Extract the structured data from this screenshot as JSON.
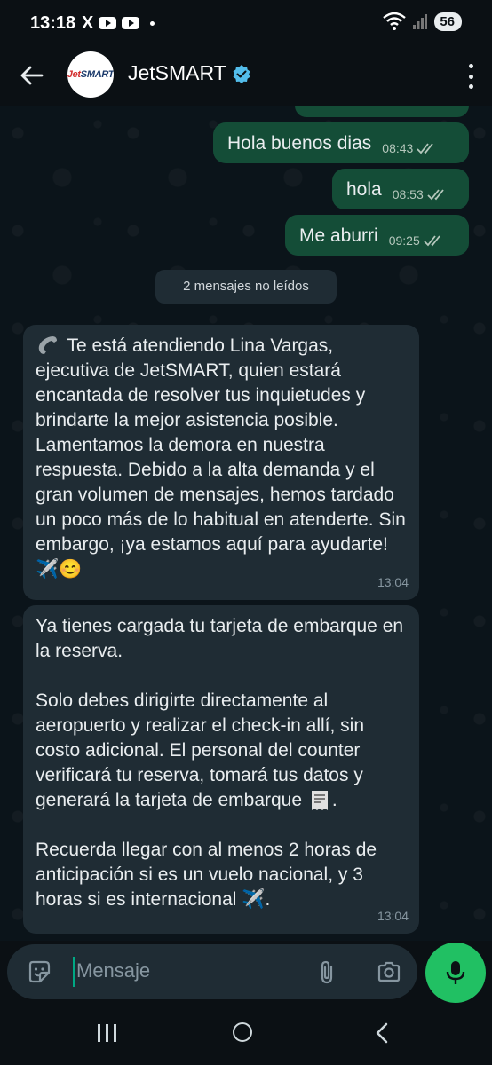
{
  "status_bar": {
    "time": "13:18",
    "x_icon": "X",
    "battery": "56"
  },
  "header": {
    "name": "JetSMART",
    "avatar_text_a": "Jet",
    "avatar_text_b": "SMART"
  },
  "chat": {
    "outgoing": [
      {
        "text": "Hola buenos dias",
        "time": "08:43"
      },
      {
        "text": "hola",
        "time": "08:53"
      },
      {
        "text": "Me aburri",
        "time": "09:25"
      }
    ],
    "unread_label": "2 mensajes no leídos",
    "incoming": [
      {
        "prefix_icon": "telephone-icon",
        "text": "Te está atendiendo Lina Vargas, ejecutiva de JetSMART, quien estará encantada de resolver tus inquietudes y brindarte la mejor asistencia posible. Lamentamos la demora en nuestra respuesta. Debido a la alta demanda y el gran volumen de mensajes, hemos tardado un poco más de lo habitual en atenderte. Sin embargo, ¡ya estamos aquí para ayudarte!",
        "emojis": "✈️😊",
        "time": "13:04"
      },
      {
        "p1": "Ya tienes cargada tu tarjeta de embarque en la reserva.",
        "p2": "Solo debes dirigirte directamente al aeropuerto y realizar el check-in allí, sin costo adicional. El personal del counter verificará tu reserva, tomará tus datos y generará la tarjeta de embarque",
        "p2_end": ".",
        "p3": "Recuerda llegar con al menos 2 horas de anticipación si es un vuelo nacional, y 3 horas si es internacional",
        "p3_emoji": "✈️",
        "p3_end": ".",
        "time": "13:04"
      }
    ]
  },
  "input": {
    "placeholder": "Mensaje"
  },
  "colors": {
    "accent": "#21c063",
    "outgoing_bubble": "#144d37",
    "incoming_bubble": "#1f2c34",
    "tick": "#b6c8bd"
  }
}
